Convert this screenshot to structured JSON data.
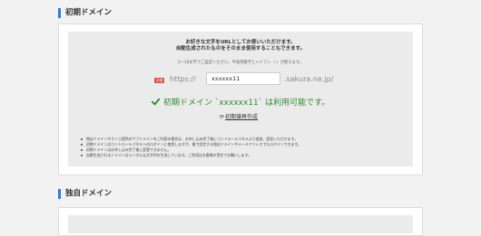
{
  "sections": {
    "initial_title": "初期ドメイン",
    "custom_title": "独自ドメイン"
  },
  "initial": {
    "lead1": "お好きな文字をURLとしてお使いいただけます。",
    "lead2": "自動生成されたものをそのまま使用することもできます。",
    "note": "3〜16文字でご設定ください。半角英数字とハイフン（-）が使えます。",
    "badge": "必須",
    "protocol": "https://",
    "input_value": "xxxxxx11",
    "suffix": ".sakura.ne.jp/",
    "availability": "初期ドメイン `xxxxxx11` は利用可能です。",
    "regenerate": "初期値再作成",
    "bullets": [
      "独自ドメインやさくら提供のサブドメインをご利用の場合は、お申し込み完了後にコントロールパネルより追加、設定いただけます。",
      "初期ドメインはコントロールパネルへのログインに使用しますが、後で設定する独自ドメインやメールアドレスでもログインできます。",
      "初期ドメインはお申し込み完了後に変更できません。",
      "自動生成されるドメインはランダムな文字列を生成しています。ご利用はお客様の責任でお願いします。"
    ]
  },
  "colors": {
    "accent": "#3a7bbf",
    "available": "#2e8b2e",
    "required_badge": "#d9534f"
  },
  "icons": {
    "check": "check-icon",
    "refresh": "refresh-icon"
  }
}
